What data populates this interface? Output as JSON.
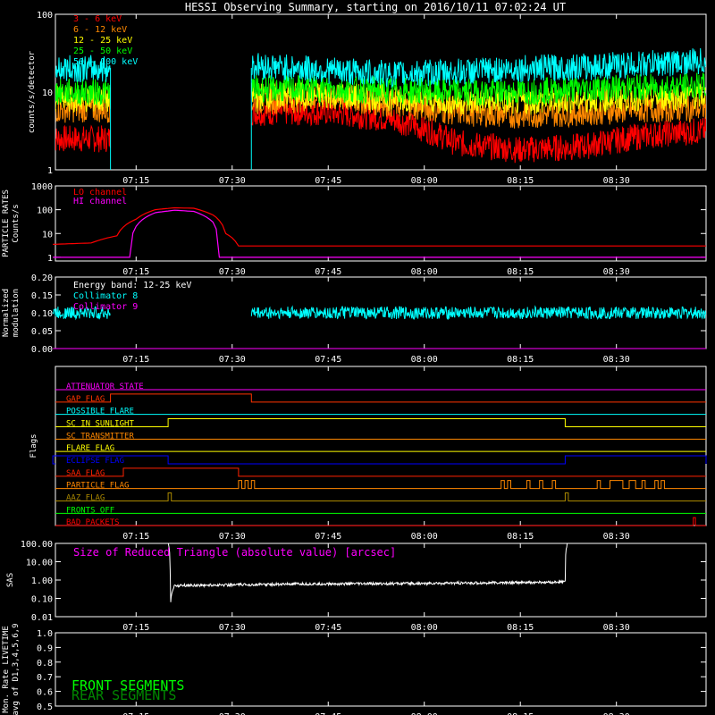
{
  "title": "HESSI Observing Summary, starting on 2016/10/11 07:02:24 UT",
  "colors": {
    "background": "#000000",
    "axes": "#ffffff",
    "e_3_6": "#ff0000",
    "e_6_12": "#ff8800",
    "e_12_25": "#ffff00",
    "e_25_50": "#00ff00",
    "e_50_100": "#00ffff",
    "lo_channel": "#ff0000",
    "hi_channel": "#ff00ff",
    "collimator_8": "#00ffff",
    "collimator_9": "#ff00ff",
    "sas": "#ffffff",
    "front_segments": "#00ff00",
    "rear_segments": "#008800"
  },
  "time_axis": {
    "start": "07:02:24",
    "end": "08:44",
    "tick_labels": [
      "07:15",
      "07:30",
      "07:45",
      "08:00",
      "08:15",
      "08:30"
    ]
  },
  "chart_data": [
    {
      "panel": "count-rates",
      "type": "line",
      "ylabel": "counts/s/detector",
      "yscale": "log",
      "ylim": [
        1,
        100
      ],
      "ytick_labels": [
        "1",
        "10",
        "100"
      ],
      "data_gaps": [
        [
          "07:11",
          "07:33"
        ]
      ],
      "series": [
        {
          "name": "3 - 6 keV",
          "color": "#ff0000",
          "points": [
            [
              "07:02",
              2.5
            ],
            [
              "07:11",
              2.5
            ],
            [
              "07:33",
              5.5
            ],
            [
              "07:45",
              5.5
            ],
            [
              "07:55",
              4.5
            ],
            [
              "08:05",
              2.2
            ],
            [
              "08:15",
              1.8
            ],
            [
              "08:25",
              2.0
            ],
            [
              "08:35",
              2.8
            ],
            [
              "08:44",
              3.2
            ]
          ]
        },
        {
          "name": "6 - 12 keV",
          "color": "#ff8800",
          "points": [
            [
              "07:02",
              6.0
            ],
            [
              "07:11",
              6.0
            ],
            [
              "07:33",
              7.5
            ],
            [
              "07:45",
              8.5
            ],
            [
              "07:55",
              7.0
            ],
            [
              "08:05",
              5.5
            ],
            [
              "08:15",
              5.0
            ],
            [
              "08:25",
              5.5
            ],
            [
              "08:35",
              6.0
            ],
            [
              "08:44",
              6.2
            ]
          ]
        },
        {
          "name": "12 - 25 keV",
          "color": "#ffff00",
          "points": [
            [
              "07:02",
              8.0
            ],
            [
              "07:11",
              8.0
            ],
            [
              "07:33",
              9.0
            ],
            [
              "07:45",
              9.0
            ],
            [
              "07:55",
              8.5
            ],
            [
              "08:05",
              7.5
            ],
            [
              "08:15",
              7.5
            ],
            [
              "08:25",
              8.0
            ],
            [
              "08:35",
              8.5
            ],
            [
              "08:44",
              9.0
            ]
          ]
        },
        {
          "name": "25 - 50 keV",
          "color": "#00ff00",
          "points": [
            [
              "07:02",
              10.0
            ],
            [
              "07:11",
              10.0
            ],
            [
              "07:33",
              11.0
            ],
            [
              "07:45",
              11.0
            ],
            [
              "07:55",
              10.5
            ],
            [
              "08:05",
              10.0
            ],
            [
              "08:15",
              10.0
            ],
            [
              "08:25",
              11.0
            ],
            [
              "08:35",
              11.5
            ],
            [
              "08:44",
              12.0
            ]
          ]
        },
        {
          "name": "50 - 100 keV",
          "color": "#00ffff",
          "points": [
            [
              "07:02",
              20.0
            ],
            [
              "07:11",
              20.0
            ],
            [
              "07:33",
              22.0
            ],
            [
              "07:45",
              19.0
            ],
            [
              "07:55",
              17.0
            ],
            [
              "08:05",
              18.0
            ],
            [
              "08:15",
              20.0
            ],
            [
              "08:25",
              21.0
            ],
            [
              "08:35",
              23.0
            ],
            [
              "08:44",
              25.0
            ]
          ]
        }
      ]
    },
    {
      "panel": "particle-rates",
      "type": "line",
      "ylabel": "PARTICLE RATES Counts/s",
      "yscale": "log",
      "ylim": [
        0.7,
        1000
      ],
      "ytick_labels": [
        "1",
        "10",
        "100",
        "1000"
      ],
      "series": [
        {
          "name": "LO channel",
          "color": "#ff0000",
          "points": [
            [
              "07:02",
              3.5
            ],
            [
              "07:08",
              4.0
            ],
            [
              "07:12",
              8.0
            ],
            [
              "07:15",
              40
            ],
            [
              "07:18",
              100
            ],
            [
              "07:21",
              120
            ],
            [
              "07:24",
              115
            ],
            [
              "07:27",
              60
            ],
            [
              "07:29",
              10
            ],
            [
              "07:31",
              3.0
            ],
            [
              "08:44",
              3.0
            ]
          ]
        },
        {
          "name": "HI channel",
          "color": "#ff00ff",
          "points": [
            [
              "07:02",
              1.0
            ],
            [
              "07:14",
              1.0
            ],
            [
              "07:15",
              20
            ],
            [
              "07:18",
              75
            ],
            [
              "07:21",
              95
            ],
            [
              "07:24",
              85
            ],
            [
              "07:27",
              30
            ],
            [
              "07:28",
              1.0
            ],
            [
              "08:44",
              1.0
            ]
          ]
        }
      ]
    },
    {
      "panel": "modulation",
      "type": "line",
      "ylabel": "Normalized modulation",
      "ylim": [
        0.0,
        0.2
      ],
      "ytick_labels": [
        "0.00",
        "0.05",
        "0.10",
        "0.15",
        "0.20"
      ],
      "annotation": "Energy band: 12-25 keV",
      "series": [
        {
          "name": "Collimator 8",
          "color": "#00ffff",
          "segments": [
            [
              [
                "07:02",
                0.1
              ],
              [
                "07:11",
                0.1
              ]
            ],
            [
              [
                "07:33",
                0.1
              ],
              [
                "08:44",
                0.1
              ]
            ]
          ]
        },
        {
          "name": "Collimator 9",
          "color": "#ff00ff",
          "segments": [
            [
              [
                "07:02",
                0.0
              ],
              [
                "08:44",
                0.0
              ]
            ]
          ]
        }
      ]
    },
    {
      "panel": "flags",
      "type": "table",
      "ylabel": "Flags",
      "flags": [
        {
          "name": "ATTENUATOR STATE",
          "color": "#ff00ff",
          "on": []
        },
        {
          "name": "GAP FLAG",
          "color": "#ff3300",
          "on": [
            [
              "07:11",
              "07:33"
            ]
          ]
        },
        {
          "name": "POSSIBLE FLARE",
          "color": "#00ffff",
          "on": []
        },
        {
          "name": "SC IN SUNLIGHT",
          "color": "#ffff00",
          "on": [
            [
              "07:20",
              "08:22"
            ]
          ]
        },
        {
          "name": "SC TRANSMITTER",
          "color": "#ff8800",
          "on": []
        },
        {
          "name": "FLARE FLAG",
          "color": "#ffff00",
          "on": []
        },
        {
          "name": "ECLIPSE FLAG",
          "color": "#0000ff",
          "on": [
            [
              "07:02",
              "07:20"
            ],
            [
              "08:22",
              "08:44"
            ]
          ]
        },
        {
          "name": "SAA FLAG",
          "color": "#ff2200",
          "on": [
            [
              "07:13",
              "07:31"
            ]
          ]
        },
        {
          "name": "PARTICLE FLAG",
          "color": "#ff8800",
          "on": [
            [
              "07:31",
              "07:31:30"
            ],
            [
              "07:32",
              "07:32:30"
            ],
            [
              "07:33",
              "07:33:30"
            ],
            [
              "08:12",
              "08:12:30"
            ],
            [
              "08:13",
              "08:13:30"
            ],
            [
              "08:16",
              "08:16:30"
            ],
            [
              "08:18",
              "08:18:30"
            ],
            [
              "08:20",
              "08:20:30"
            ],
            [
              "08:27",
              "08:27:30"
            ],
            [
              "08:29",
              "08:31"
            ],
            [
              "08:32",
              "08:33"
            ],
            [
              "08:34",
              "08:34:30"
            ],
            [
              "08:36",
              "08:36:30"
            ],
            [
              "08:37",
              "08:37:30"
            ]
          ]
        },
        {
          "name": "AAZ FLAG",
          "color": "#aa8800",
          "on": [
            [
              "07:20",
              "07:20:30"
            ],
            [
              "08:22",
              "08:22:30"
            ]
          ]
        },
        {
          "name": "FRONTS OFF",
          "color": "#00ff00",
          "on": []
        },
        {
          "name": "BAD PACKETS",
          "color": "#ff0000",
          "on": [
            [
              "08:42",
              "08:42:20"
            ]
          ]
        }
      ]
    },
    {
      "panel": "sas",
      "type": "line",
      "ylabel": "SAS",
      "yscale": "log",
      "ylim": [
        0.01,
        100
      ],
      "ytick_labels": [
        "0.01",
        "0.10",
        "1.00",
        "10.00",
        "100.00"
      ],
      "annotation": "Size of Reduced Triangle (absolute value) [arcsec]",
      "series": [
        {
          "name": "",
          "color": "#ffffff",
          "points": [
            [
              "07:20",
              100
            ],
            [
              "07:20:20",
              0.01
            ],
            [
              "07:21",
              0.5
            ],
            [
              "07:40",
              0.6
            ],
            [
              "08:00",
              0.65
            ],
            [
              "08:20",
              0.75
            ],
            [
              "08:22",
              0.8
            ],
            [
              "08:22:20",
              100
            ]
          ]
        }
      ]
    },
    {
      "panel": "livetime",
      "type": "line",
      "ylabel": "Mon. Rate LIVETIME avg of D1,3,4,5,6,9",
      "ylim": [
        0.5,
        1.0
      ],
      "ytick_labels": [
        "0.5",
        "0.6",
        "0.7",
        "0.8",
        "0.9",
        "1.0"
      ],
      "series": [
        {
          "name": "FRONT SEGMENTS",
          "color": "#00ff00",
          "points": []
        },
        {
          "name": "REAR SEGMENTS",
          "color": "#008800",
          "points": []
        }
      ]
    }
  ]
}
